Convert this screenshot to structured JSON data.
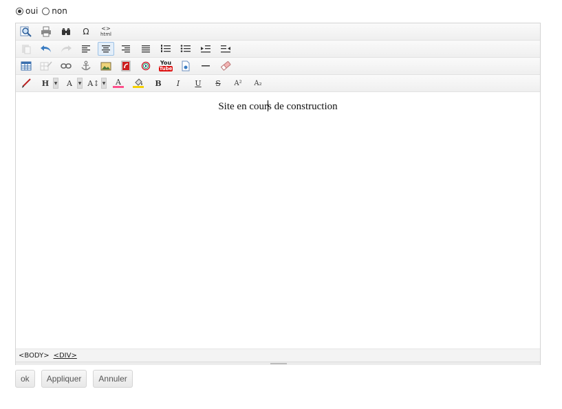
{
  "visibility": {
    "options": [
      {
        "label": "oui",
        "checked": true
      },
      {
        "label": "non",
        "checked": false
      }
    ]
  },
  "toolbar": {
    "row1": [
      "preview-icon",
      "print-icon",
      "find-icon",
      "special-char-icon",
      "html-source-icon"
    ],
    "html_label": "html",
    "omega": "Ω",
    "heading_label": "H",
    "font_label": "A",
    "font_size_label": "A↕",
    "font_color_label": "A",
    "bold": "B",
    "italic": "I",
    "underline": "U",
    "strike": "S",
    "superscript": "A²",
    "subscript": "A₂",
    "youtube_top": "You",
    "youtube_bottom": "Tube",
    "accent_color": "#ff4f8b",
    "highlight_color": "#f5d000"
  },
  "editor": {
    "content_before_cursor": "Site en cour",
    "content_after_cursor": "s de construction"
  },
  "statusbar": {
    "path": [
      "<BODY>",
      "<DIV>"
    ]
  },
  "actions": {
    "ok": "ok",
    "apply": "Appliquer",
    "cancel": "Annuler"
  }
}
